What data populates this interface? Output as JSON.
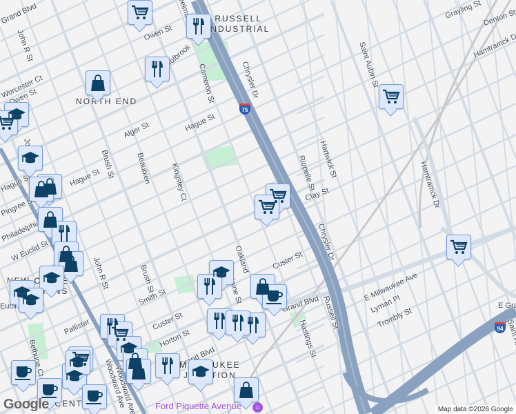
{
  "map": {
    "attribution": "Map data ©2026 Google",
    "logo": "Google",
    "poi": "Ford Piquette Avenue",
    "highways": [
      "75",
      "94"
    ],
    "colors": {
      "background": "#f4f3f4",
      "road": "#d3dce4",
      "freeway": "#8aa2bf",
      "park": "#c6efd4",
      "marker_bg": "#dde8fb",
      "marker_icon": "#0d4166"
    },
    "neighborhoods": [
      {
        "lines": [
          "RUSSELL",
          "INDUSTRIAL"
        ]
      },
      {
        "lines": [
          "NORTH END"
        ]
      },
      {
        "lines": [
          "NEW CENTER",
          "COMMONS"
        ]
      },
      {
        "lines": [
          "MILWAUKEE",
          "JUNCTION"
        ]
      },
      {
        "lines": [
          "NEW CENTER"
        ]
      }
    ],
    "streets": [
      "Grand Blvd",
      "John R St",
      "Owen St",
      "Delmar St",
      "Chrysler Dr",
      "Cameron St",
      "Holbrook",
      "Worcester Ct",
      "Owen St",
      "Alger St",
      "Hague St",
      "Beaubien",
      "Brush St",
      "John R St",
      "Hague St",
      "Kingsley Ct",
      "Hague St",
      "Pingree St",
      "Philadelphia St",
      "W Euclid St",
      "John R St",
      "Brush St",
      "Oakland",
      "Smith St",
      "Custer St",
      "Horton St",
      "Pallister",
      "Bethune Ct",
      "Woodward Ave",
      "Grand Blvd",
      "Alpine St",
      "Custer St",
      "Grand Blvd",
      "Hastings St",
      "Chrysler Dr",
      "Clay St",
      "Riopelle St",
      "Hartwick St",
      "Saint Aubin St",
      "Hamtramck Dr",
      "Russell St",
      "E Milwaukee Ave",
      "Lyman Pl",
      "Trombly St",
      "E Grand Blvd",
      "Saint Aubin St",
      "Grayling St",
      "Denton St",
      "Hamtramck Dr",
      "Euclid St",
      "Woodward Ave",
      "Hastings St"
    ],
    "markers": [
      "cart",
      "fork",
      "fork",
      "bag",
      "school",
      "cart",
      "school",
      "bag",
      "bag",
      "bag",
      "fork",
      "bag",
      "bag",
      "school",
      "school",
      "school",
      "school",
      "fork",
      "bag",
      "cup",
      "fork",
      "cart",
      "school",
      "bag",
      "bag",
      "fork",
      "school",
      "fork",
      "fork",
      "fork",
      "cup",
      "cart",
      "school",
      "cup",
      "cup",
      "bag",
      "cart",
      "cart",
      "cart",
      "cart",
      "school"
    ]
  }
}
